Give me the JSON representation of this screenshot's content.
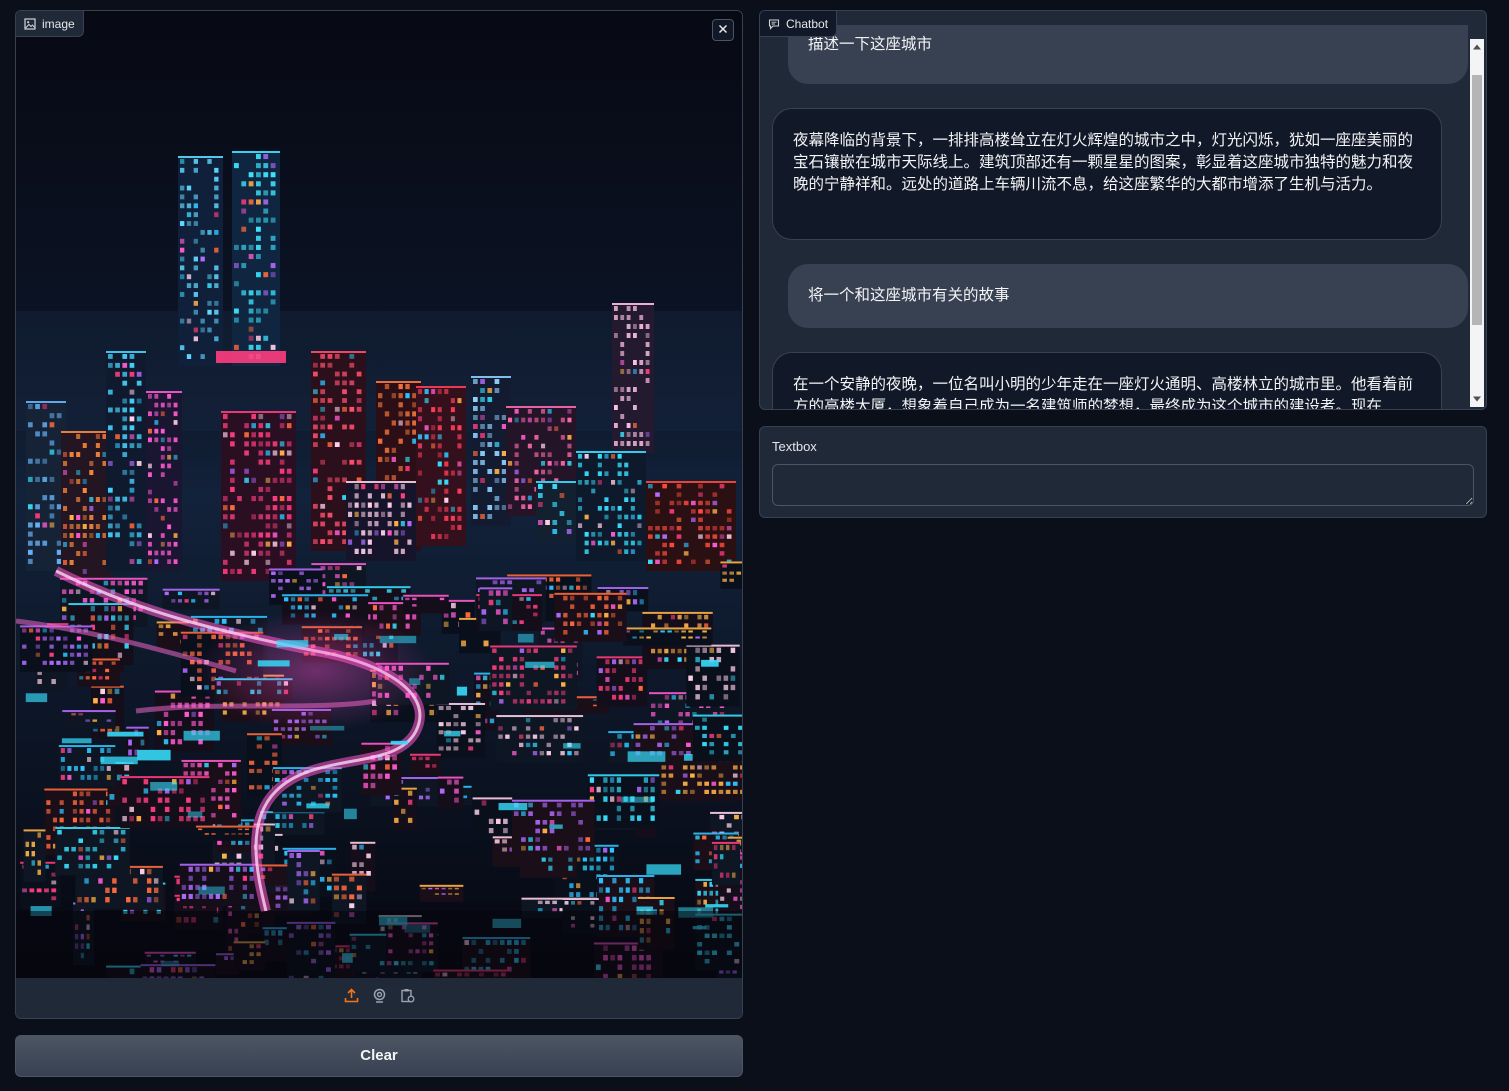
{
  "image_panel": {
    "label": "image",
    "label_icon": "image-icon",
    "close_icon": "close-icon",
    "toolbar_icons": [
      "upload-icon",
      "webcam-icon",
      "clipboard-icon"
    ]
  },
  "clear_button": {
    "label": "Clear"
  },
  "chatbot": {
    "label": "Chatbot",
    "label_icon": "chat-icon",
    "messages": [
      {
        "role": "user",
        "text": "描述一下这座城市"
      },
      {
        "role": "bot",
        "text": "夜幕降临的背景下，一排排高楼耸立在灯火辉煌的城市之中，灯光闪烁，犹如一座座美丽的宝石镶嵌在城市天际线上。建筑顶部还有一颗星星的图案，彰显着这座城市独特的魅力和夜晚的宁静祥和。远处的道路上车辆川流不息，给这座繁华的大都市增添了生机与活力。"
      },
      {
        "role": "user",
        "text": "将一个和这座城市有关的故事"
      },
      {
        "role": "bot",
        "text": "在一个安静的夜晚，一位名叫小明的少年走在一座灯火通明、高楼林立的城市里。他看着前方的高楼大厦，想象着自己成为一名建筑师的梦想，最终成为这个城市的建设者。现在"
      }
    ]
  },
  "textbox": {
    "label": "Textbox",
    "value": "",
    "placeholder": ""
  },
  "colors": {
    "accent": "#f97316",
    "background": "#0b0f19",
    "panel": "#1f2937",
    "border": "#374151"
  }
}
